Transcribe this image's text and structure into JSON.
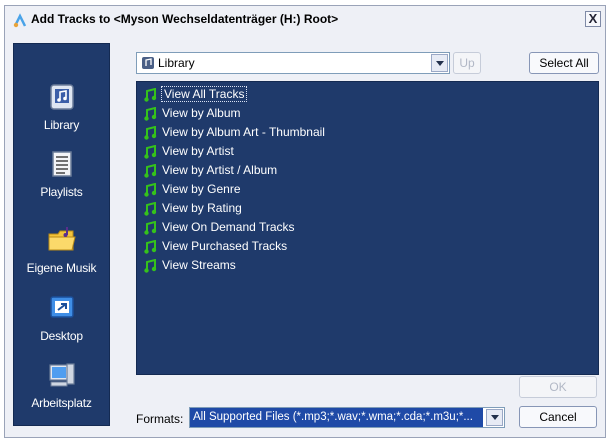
{
  "window": {
    "title": "Add Tracks to <Myson Wechseldatenträger (H:) Root>",
    "close_label": "X"
  },
  "places": [
    {
      "label": "Library",
      "icon": "library-icon"
    },
    {
      "label": "Playlists",
      "icon": "playlists-icon"
    },
    {
      "label": "Eigene Musik",
      "icon": "folder-music-icon"
    },
    {
      "label": "Desktop",
      "icon": "desktop-icon"
    },
    {
      "label": "Arbeitsplatz",
      "icon": "computer-icon"
    }
  ],
  "look_in": {
    "value": "Library",
    "icon": "library-icon"
  },
  "buttons": {
    "up": "Up",
    "select_all": "Select All",
    "ok": "OK",
    "cancel": "Cancel"
  },
  "list": {
    "selected_index": 0,
    "items": [
      "View All Tracks",
      "View by Album",
      "View by Album Art - Thumbnail",
      "View by Artist",
      "View by Artist / Album",
      "View by Genre",
      "View by Rating",
      "View On Demand Tracks",
      "View Purchased Tracks",
      "View Streams"
    ]
  },
  "formats": {
    "label": "Formats:",
    "value": "All Supported Files (*.mp3;*.wav;*.wma;*.cda;*.m3u;*..."
  },
  "colors": {
    "panel": "#1f3a6b",
    "note_icon": "#35c21b",
    "selected_field": "#1f4aa7"
  }
}
